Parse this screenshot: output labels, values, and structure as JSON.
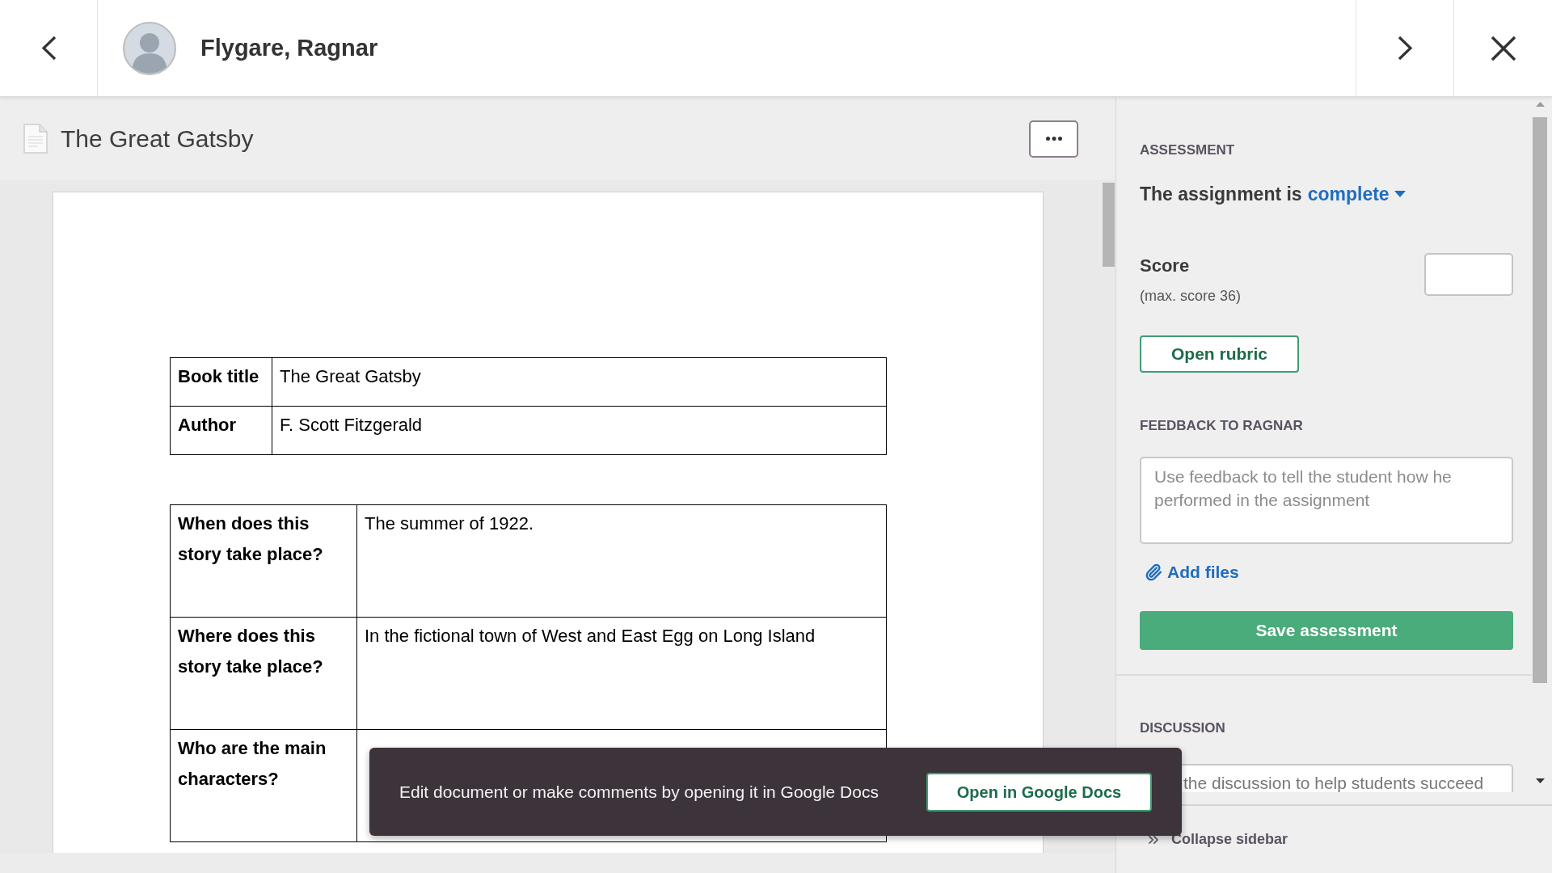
{
  "header": {
    "student_name": "Flygare, Ragnar"
  },
  "document": {
    "title": "The Great Gatsby",
    "tables": [
      {
        "rows": [
          {
            "label": "Book title",
            "value": "The Great Gatsby"
          },
          {
            "label": "Author",
            "value": "F. Scott Fitzgerald"
          }
        ]
      },
      {
        "rows": [
          {
            "label": "When does this story take place?",
            "value": "The summer of 1922."
          },
          {
            "label": "Where does this story take place?",
            "value": "In the fictional town of West and East Egg on Long Island"
          },
          {
            "label": "Who are the main characters?"
          }
        ]
      }
    ]
  },
  "sidebar": {
    "assessment": {
      "heading": "ASSESSMENT",
      "status_text": "The assignment is",
      "status": "complete",
      "score_label": "Score",
      "score_note": "(max. score 36)",
      "rubric_button": "Open rubric"
    },
    "feedback": {
      "heading": "FEEDBACK TO RAGNAR",
      "placeholder": "Use feedback to tell the student how he performed in the assignment",
      "add_files": "Add files",
      "save_button": "Save assessment"
    },
    "discussion": {
      "heading": "DISCUSSION",
      "placeholder": "the discussion to help students succeed"
    },
    "collapse_button": "Collapse sidebar"
  },
  "toast": {
    "message": "Edit document or make comments by opening it in Google Docs",
    "button": "Open in Google Docs"
  }
}
